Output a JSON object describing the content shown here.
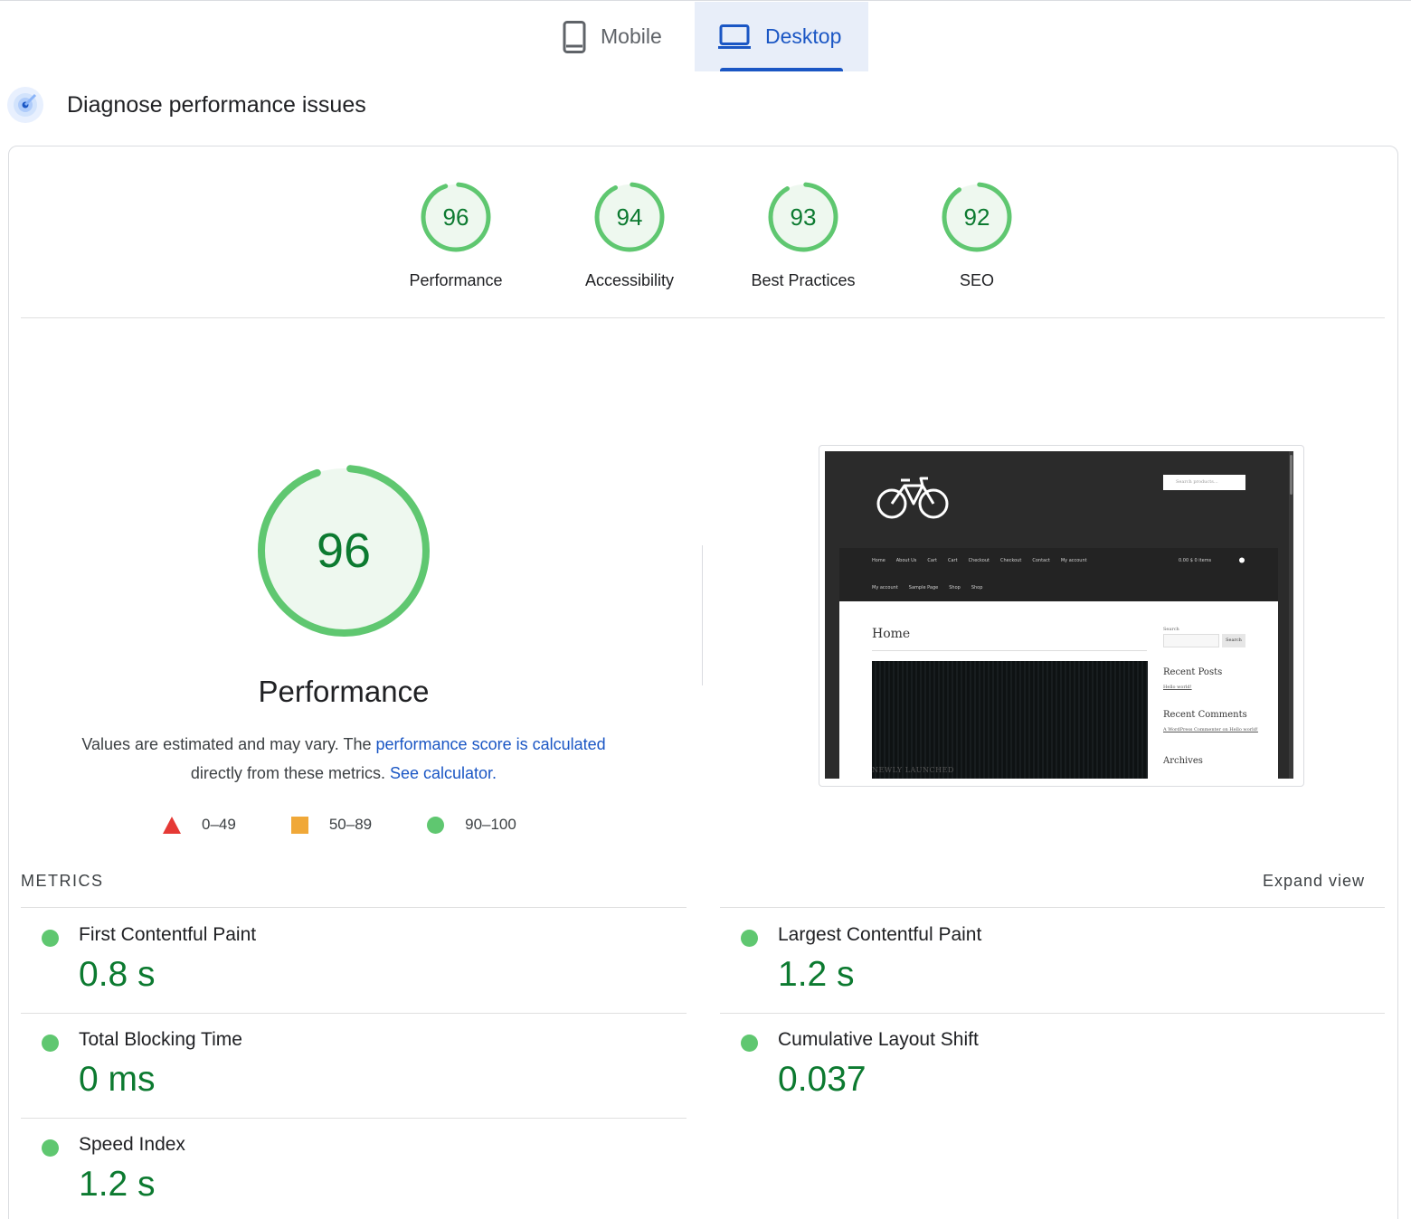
{
  "tabs": {
    "mobile": "Mobile",
    "desktop": "Desktop"
  },
  "diagnose": {
    "title": "Diagnose performance issues"
  },
  "colors": {
    "pass_green": "#0c7a30",
    "ring_green": "#5fc770",
    "fail_red": "#e53935",
    "average_orange": "#f0a838",
    "link_blue": "#1a56c4"
  },
  "scores": [
    {
      "label": "Performance",
      "value": "96",
      "score": 96
    },
    {
      "label": "Accessibility",
      "value": "94",
      "score": 94
    },
    {
      "label": "Best Practices",
      "value": "93",
      "score": 93
    },
    {
      "label": "SEO",
      "value": "92",
      "score": 92
    }
  ],
  "performance": {
    "score": "96",
    "score_value": 96,
    "title": "Performance",
    "desc_prefix": "Values are estimated and may vary. The ",
    "desc_link1": "performance score is calculated",
    "desc_middle": " directly from these metrics. ",
    "desc_link2": "See calculator."
  },
  "legend": {
    "fail": "0–49",
    "average": "50–89",
    "pass": "90–100"
  },
  "screenshot": {
    "search_placeholder": "Search products…",
    "nav_row1": [
      "Home",
      "About Us",
      "Cart",
      "Cart",
      "Checkout",
      "Checkout",
      "Contact",
      "My account"
    ],
    "nav_row2": [
      "My account",
      "Sample Page",
      "Shop",
      "Shop"
    ],
    "cart": "0.00 $  0 items",
    "page_title": "Home",
    "hero_text": "NEWLY LAUNCHED",
    "search_label": "Search",
    "search_button": "Search",
    "recent_posts": "Recent Posts",
    "hello_world": "Hello world!",
    "recent_comments": "Recent Comments",
    "comment": "A WordPress Commenter on Hello world!",
    "archives": "Archives"
  },
  "metrics": {
    "heading": "METRICS",
    "expand": "Expand view",
    "fcp": {
      "title": "First Contentful Paint",
      "value": "0.8 s"
    },
    "lcp": {
      "title": "Largest Contentful Paint",
      "value": "1.2 s"
    },
    "tbt": {
      "title": "Total Blocking Time",
      "value": "0 ms"
    },
    "cls": {
      "title": "Cumulative Layout Shift",
      "value": "0.037"
    },
    "si": {
      "title": "Speed Index",
      "value": "1.2 s"
    }
  }
}
